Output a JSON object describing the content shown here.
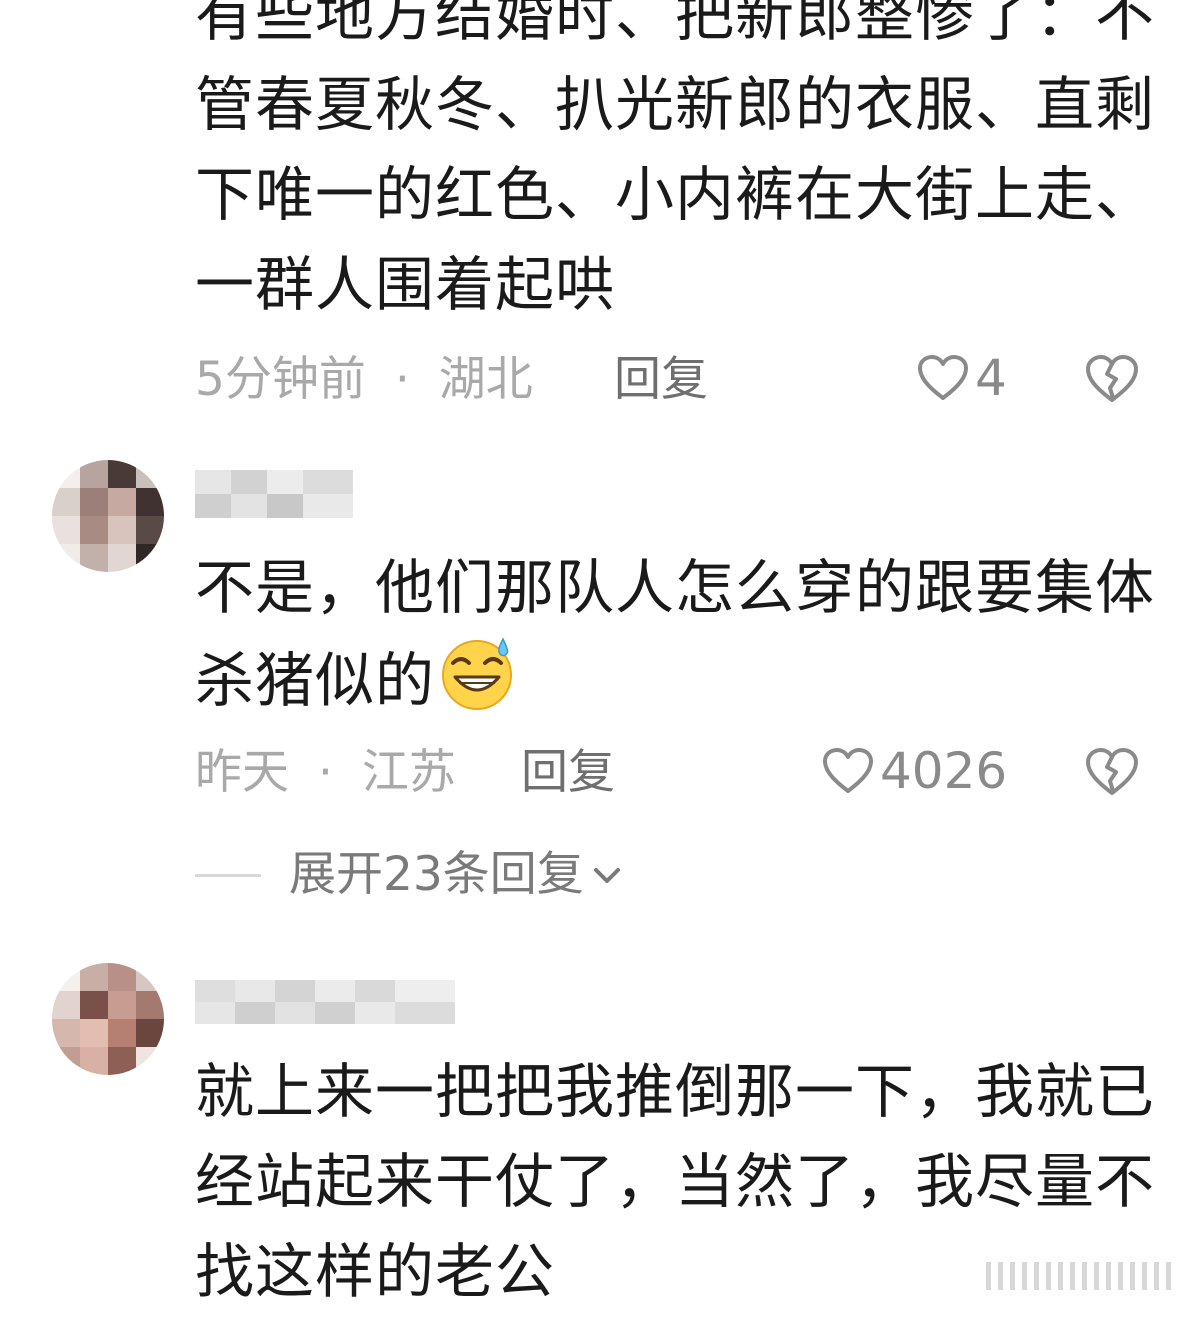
{
  "comments": [
    {
      "text": "有些地方结婚时、把新郎整惨了：不管春夏秋冬、扒光新郎的衣服、直剩下唯一的红色、小内裤在大街上走、一群人围着起哄",
      "time": "5分钟前",
      "location": "湖北",
      "separator": "·",
      "reply_label": "回复",
      "likes": "4",
      "username_blurred": true,
      "avatar_visible": false
    },
    {
      "text": "不是，他们那队人怎么穿的跟要集体杀猪似的",
      "emoji": "sweat-grin-emoji",
      "time": "昨天",
      "location": "江苏",
      "separator": "·",
      "reply_label": "回复",
      "likes": "4026",
      "username_blurred": true,
      "avatar_visible": true,
      "expand_label": "展开23条回复"
    },
    {
      "text": "就上来一把把我推倒那一下，我就已经站起来干仗了，当然了，我尽量不找这样的老公",
      "username_blurred": true,
      "avatar_visible": true
    }
  ],
  "icons": {
    "like": "heart-outline-icon",
    "dislike": "broken-heart-icon",
    "expand": "chevron-down-icon"
  },
  "colors": {
    "text": "#1a1a1a",
    "meta": "#a9a9a9",
    "reply": "#6f6f6f",
    "icon": "#8a8a8a"
  }
}
